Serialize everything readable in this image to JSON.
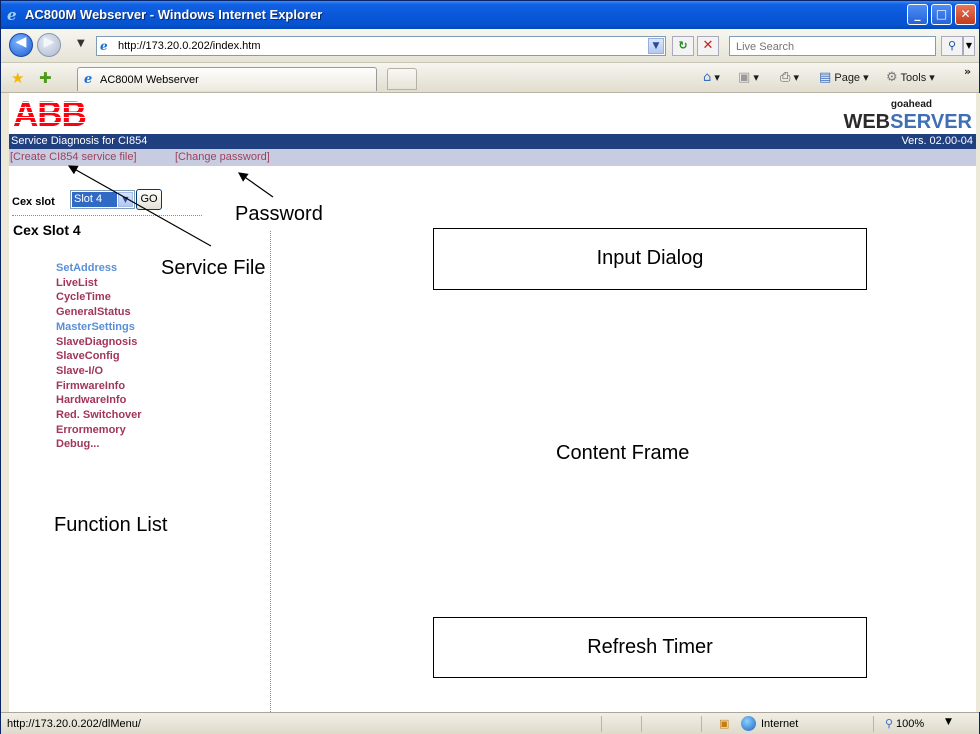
{
  "window": {
    "title": "AC800M Webserver - Windows Internet Explorer",
    "minimize_glyph": "_",
    "maximize_glyph": "□",
    "close_glyph": "✕"
  },
  "addressbar": {
    "url": "http://173.20.0.202/index.htm",
    "search_placeholder": "Live Search"
  },
  "tabs": [
    {
      "label": "AC800M Webserver"
    }
  ],
  "commandbar": {
    "page_label": "Page",
    "tools_label": "Tools"
  },
  "page": {
    "logo_text": "ABB",
    "webserver_sub": "goahead",
    "webserver_main_1": "WEB",
    "webserver_main_2": "SERVER",
    "header_title": "Service Diagnosis for CI854",
    "version": "Vers. 02.00-04",
    "links": {
      "create_service_file": "[Create CI854 service file]",
      "change_password": "[Change password]"
    },
    "cex_slot_label": "Cex slot",
    "cex_slot_value": "Slot 4",
    "go_label": "GO",
    "slot_title": "Cex Slot 4",
    "functions": [
      {
        "label": "SetAddress",
        "color": "#5a8fd6"
      },
      {
        "label": "LiveList",
        "color": "#a2355a"
      },
      {
        "label": "CycleTime",
        "color": "#a2355a"
      },
      {
        "label": "GeneralStatus",
        "color": "#a2355a"
      },
      {
        "label": "MasterSettings",
        "color": "#5a8fd6"
      },
      {
        "label": "SlaveDiagnosis",
        "color": "#a2355a"
      },
      {
        "label": "SlaveConfig",
        "color": "#a2355a"
      },
      {
        "label": "Slave-I/O",
        "color": "#a2355a"
      },
      {
        "label": "FirmwareInfo",
        "color": "#a2355a"
      },
      {
        "label": "HardwareInfo",
        "color": "#a2355a"
      },
      {
        "label": "Red. Switchover",
        "color": "#a2355a"
      },
      {
        "label": "Errormemory",
        "color": "#a2355a"
      },
      {
        "label": "Debug...",
        "color": "#a2355a"
      }
    ]
  },
  "annotations": {
    "password": "Password",
    "service_file": "Service File",
    "input_dialog": "Input Dialog",
    "content_frame": "Content Frame",
    "function_list": "Function List",
    "refresh_timer": "Refresh Timer"
  },
  "statusbar": {
    "url": "http://173.20.0.202/dlMenu/",
    "zone": "Internet",
    "zoom": "100%"
  },
  "colors": {
    "header_bar": "#1f3f7f",
    "link_bar": "#c8cce0",
    "link_text": "#a0405a",
    "abb_red": "#ff000f"
  }
}
